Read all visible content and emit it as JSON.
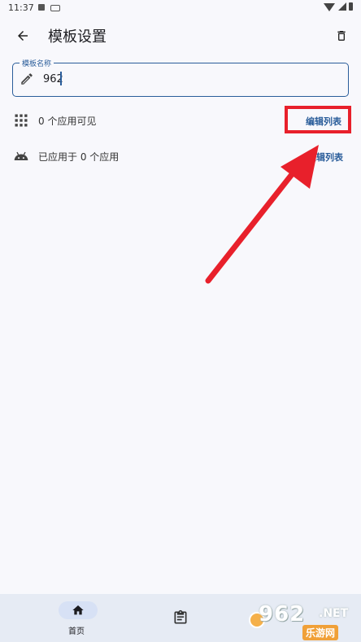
{
  "status_bar": {
    "time": "11:37"
  },
  "app_bar": {
    "title": "模板设置",
    "back_icon": "arrow-left-icon",
    "delete_icon": "trash-icon"
  },
  "template_name": {
    "label": "模板名称",
    "value": "962",
    "icon": "pencil-icon"
  },
  "rows": [
    {
      "icon": "grid-apps-icon",
      "label": "0 个应用可见",
      "action": "编辑列表"
    },
    {
      "icon": "android-icon",
      "label": "已应用于 0 个应用",
      "action": "编辑列表"
    }
  ],
  "bottom_nav": {
    "items": [
      {
        "icon": "home-icon",
        "label": "首页",
        "selected": true
      },
      {
        "icon": "clipboard-icon",
        "label": "",
        "selected": false
      }
    ]
  },
  "annotation": {
    "color": "#e8202b"
  },
  "watermark": {
    "brand": "962",
    "tld": ".NET",
    "subtitle": "乐游网"
  },
  "colors": {
    "accent": "#2a5d9a",
    "background": "#f8f8fc",
    "nav_background": "#e6ebf4"
  }
}
